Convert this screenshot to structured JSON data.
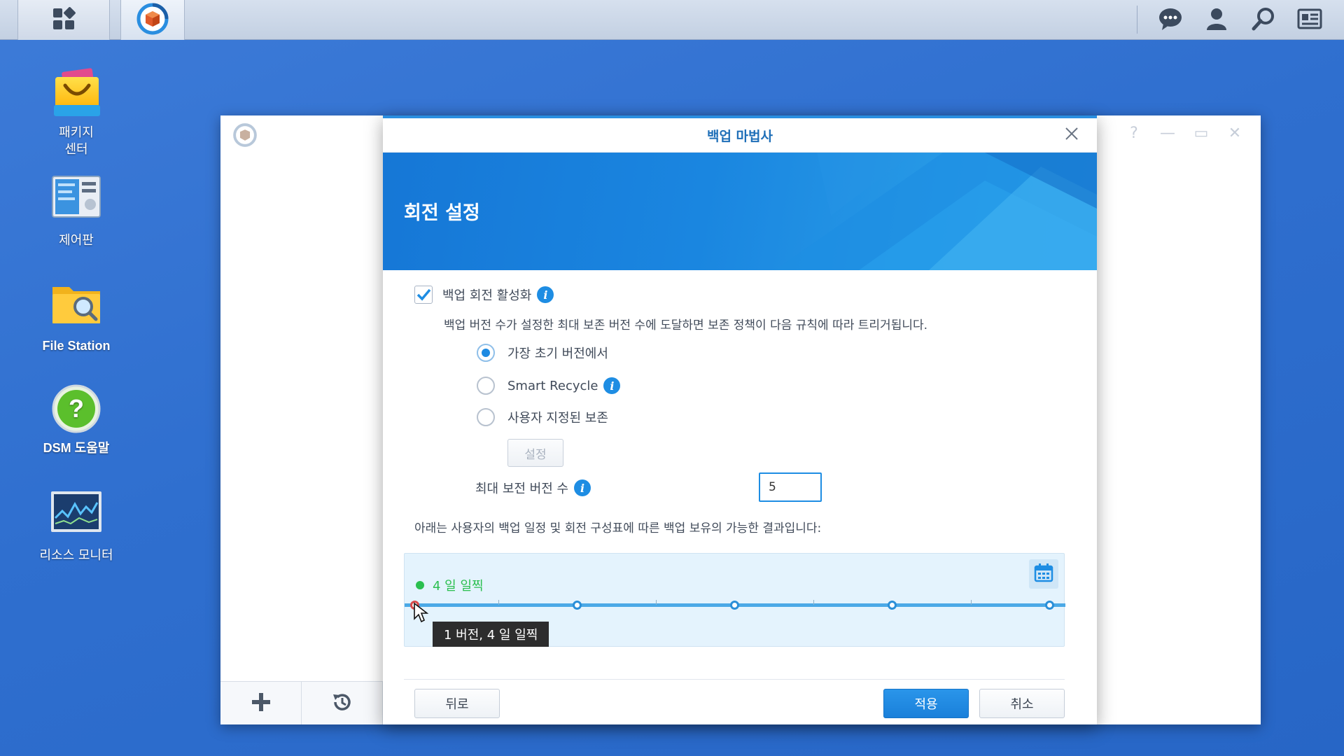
{
  "taskbar": {
    "main_menu_icon": "grid-icon",
    "active_app_icon": "hyper-backup-icon",
    "right_icons": [
      "chat-icon",
      "user-icon",
      "search-icon",
      "widgets-icon"
    ]
  },
  "desktop": {
    "icons": [
      {
        "label": "패키지\n센터",
        "line1": "패키지",
        "line2": "센터",
        "icon": "package-center-icon"
      },
      {
        "label": "제어판",
        "icon": "control-panel-icon"
      },
      {
        "label": "File Station",
        "icon": "file-station-icon"
      },
      {
        "label": "DSM 도움말",
        "icon": "dsm-help-icon"
      },
      {
        "label": "리소스 모니터",
        "icon": "resource-monitor-icon"
      }
    ]
  },
  "dialog": {
    "title": "백업 마법사",
    "banner_title": "회전 설정",
    "enable_rotation_label": "백업 회전 활성화",
    "enable_rotation_checked": true,
    "description": "백업 버전 수가 설정한 최대 보존 버전 수에 도달하면 보존 정책이 다음 규칙에 따라 트리거됩니다.",
    "options": [
      {
        "label": "가장 초기 버전에서",
        "selected": true
      },
      {
        "label": "Smart Recycle",
        "selected": false,
        "info": true
      },
      {
        "label": "사용자 지정된 보존",
        "selected": false
      }
    ],
    "settings_button": "설정",
    "max_versions_label": "최대 보전 버전 수",
    "max_versions_value": "5",
    "result_text": "아래는 사용자의 백업 일정 및 회전 구성표에 따른 백업 보유의 가능한 결과입니다:",
    "timeline_label": "4 일 일찍",
    "tooltip": "1 버전, 4 일 일찍",
    "buttons": {
      "back": "뒤로",
      "apply": "적용",
      "cancel": "취소"
    }
  },
  "colors": {
    "accent": "#1e8de3",
    "title": "#1f6fb8",
    "timeline_green": "#2bbf4f",
    "desktop": "#2f6fcf"
  }
}
